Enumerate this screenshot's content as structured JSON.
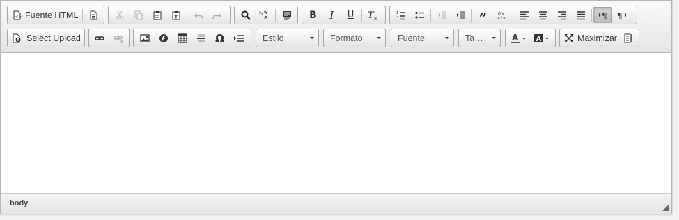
{
  "toolbar": {
    "row1": {
      "source_label": "Fuente HTML"
    },
    "row2": {
      "upload_label": "Select Upload",
      "combos": {
        "style": "Estilo",
        "format": "Formato",
        "font": "Fuente",
        "size": "Ta…"
      },
      "maximize_label": "Maximizar"
    }
  },
  "statusbar": {
    "path": "body"
  },
  "colors": {
    "toolbar_bg": "#e6e6e6",
    "border": "#a6a6a6",
    "content_bg": "#ffffff"
  }
}
